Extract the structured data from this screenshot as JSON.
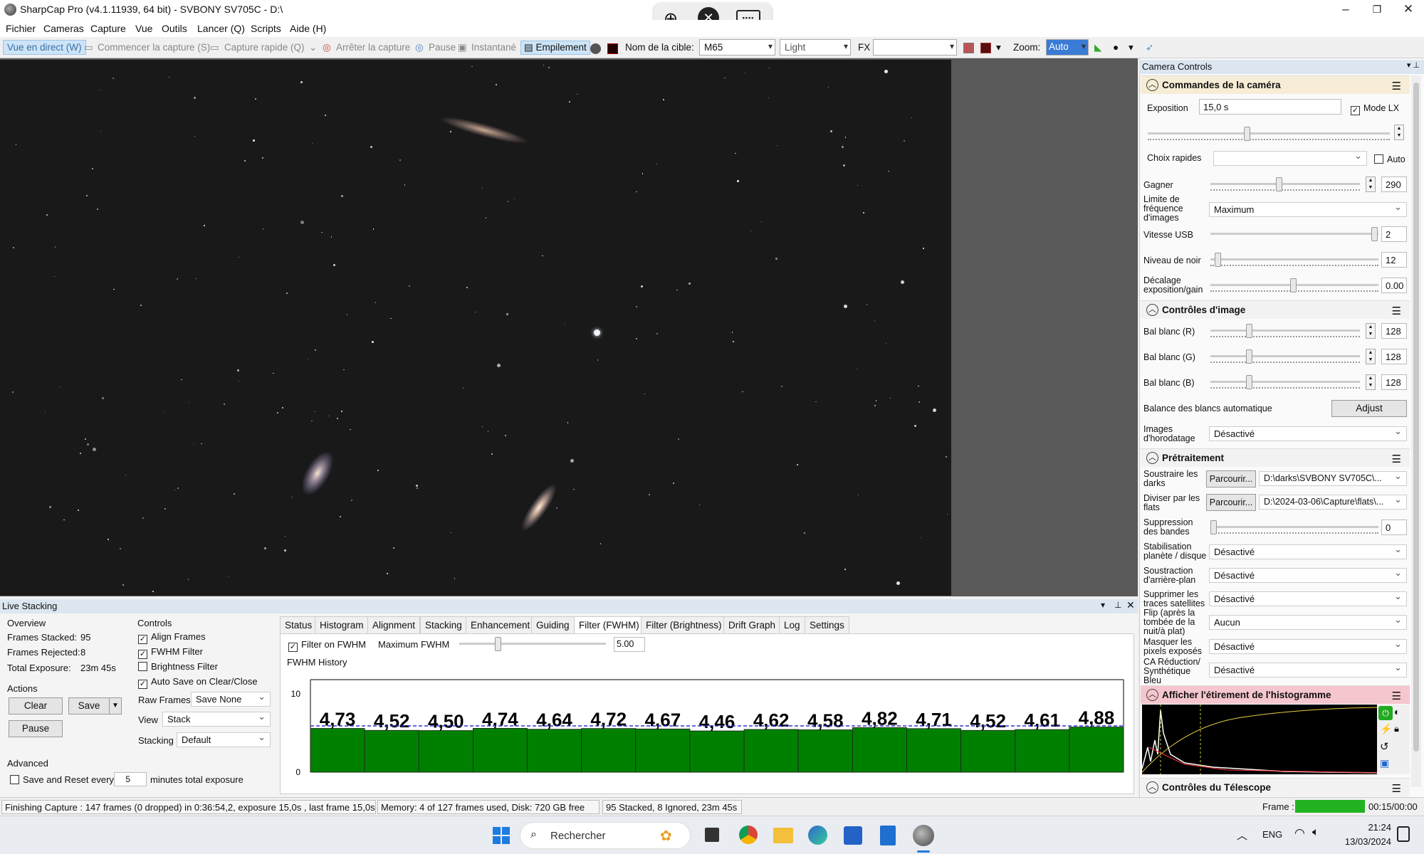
{
  "window": {
    "title": "SharpCap Pro (v4.1.11939, 64 bit) - SVBONY SV705C - D:\\"
  },
  "menu": [
    "Fichier",
    "Cameras",
    "Capture",
    "Vue",
    "Outils",
    "Lancer (Q)",
    "Scripts",
    "Aide (H)"
  ],
  "toolbar": {
    "live": "Vue en direct (W)",
    "start": "Commencer la capture (S)",
    "quick": "Capture rapide (Q)",
    "stop": "Arrêter la capture",
    "pause": "Pause",
    "snapshot": "Instantané",
    "stacking": "Empilement",
    "target_label": "Nom de la cible:",
    "target": "M65",
    "frame_type": "Light",
    "fx": "FX",
    "zoom_label": "Zoom:",
    "zoom": "Auto"
  },
  "right": {
    "panel_title": "Camera Controls",
    "camera": {
      "title": "Commandes de la caméra",
      "exposure_label": "Exposition",
      "exposure": "15,0 s",
      "lx_label": "Mode LX",
      "quick_label": "Choix rapides",
      "auto_label": "Auto",
      "gain_label": "Gagner",
      "gain": "290",
      "framerate_label": "Limite de fréquence d'images",
      "framerate": "Maximum",
      "usb_label": "Vitesse USB",
      "usb": "2",
      "black_label": "Niveau de noir",
      "black": "12",
      "offset_label": "Décalage exposition/gain",
      "offset": "0.00"
    },
    "image": {
      "title": "Contrôles d'image",
      "wbr_label": "Bal blanc (R)",
      "wbr": "128",
      "wbg_label": "Bal blanc (G)",
      "wbg": "128",
      "wbb_label": "Bal blanc (B)",
      "wbb": "128",
      "awb_label": "Balance des blancs automatique",
      "adjust": "Adjust",
      "timestamp_label": "Images d'horodatage",
      "timestamp": "Désactivé"
    },
    "pre": {
      "title": "Prétraitement",
      "darks_label": "Soustraire les darks",
      "browse": "Parcourir...",
      "darks": "D:\\darks\\SVBONY SV705C\\...",
      "flats_label": "Diviser par les flats",
      "flats": "D:\\2024-03-06\\Capture\\flats\\...",
      "banding_label": "Suppression des bandes",
      "banding": "0",
      "stab_label": "Stabilisation planète / disque",
      "stab": "Désactivé",
      "bg_label": "Soustraction d'arrière-plan",
      "bg": "Désactivé",
      "sat_label": "Supprimer les traces satellites",
      "sat": "Désactivé",
      "flip_label": "Flip (après la tombée de la nuit/à plat)",
      "flip": "Aucun",
      "hot_label": "Masquer les pixels exposés",
      "hot": "Désactivé",
      "ca_label": "CA Réduction/ Synthétique Bleu",
      "ca": "Désactivé"
    },
    "hist_title": "Afficher l'étirement de l'histogramme",
    "scope_title": "Contrôles du Télescope",
    "frame_label": "Frame :",
    "frame_time": "00:15/00:00"
  },
  "stack": {
    "title": "Live Stacking",
    "overview": "Overview",
    "stacked_label": "Frames Stacked:",
    "stacked": "95",
    "rejected_label": "Frames Rejected:",
    "rejected": "8",
    "exposure_label": "Total Exposure:",
    "exposure": "23m 45s",
    "actions": "Actions",
    "clear": "Clear",
    "save": "Save",
    "pause": "Pause",
    "advanced": "Advanced",
    "save_reset": "Save and Reset every",
    "save_reset_val": "5",
    "save_reset_suffix": "minutes total exposure",
    "controls": "Controls",
    "align": "Align Frames",
    "fwhm": "FWHM Filter",
    "bright": "Brightness Filter",
    "autosave": "Auto Save on Clear/Close",
    "raw_label": "Raw Frames",
    "raw": "Save None",
    "view_label": "View",
    "view": "Stack",
    "stacking_label": "Stacking",
    "stacking": "Default",
    "tabs": [
      "Status",
      "Histogram",
      "Alignment",
      "Stacking",
      "Enhancement",
      "Guiding",
      "Filter (FWHM)",
      "Filter (Brightness)",
      "Drift Graph",
      "Log",
      "Settings"
    ],
    "filter_on": "Filter on FWHM",
    "max_label": "Maximum FWHM",
    "max": "5.00",
    "history": "FWHM History"
  },
  "chart_data": {
    "type": "bar",
    "title": "FWHM History",
    "y_ticks": [
      "10",
      "0"
    ],
    "ylim": [
      0,
      10
    ],
    "threshold": 5.0,
    "values": [
      4.73,
      4.52,
      4.5,
      4.74,
      4.64,
      4.72,
      4.67,
      4.46,
      4.62,
      4.58,
      4.82,
      4.71,
      4.52,
      4.61,
      4.88
    ],
    "labels": [
      "4,73",
      "4,52",
      "4,50",
      "4,74",
      "4,64",
      "4,72",
      "4,67",
      "4,46",
      "4,62",
      "4,58",
      "4,82",
      "4,71",
      "4,52",
      "4,61",
      "4,88"
    ],
    "color": "#008000"
  },
  "status": {
    "capture": "Finishing Capture : 147 frames (0 dropped) in 0:36:54,2, exposure 15,0s , last frame 15,0s",
    "memory": "Memory: 4 of 127 frames used, Disk: 720 GB free",
    "stacked": "95 Stacked, 8 Ignored, 23m 45s"
  },
  "taskbar": {
    "search": "Rechercher",
    "lang": "ENG",
    "time": "21:24",
    "date": "13/03/2024"
  }
}
